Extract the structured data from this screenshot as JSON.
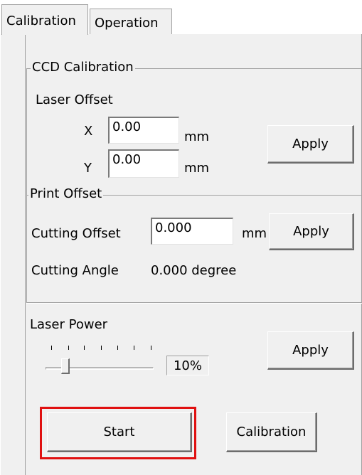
{
  "tabs": [
    {
      "label": "Calibration",
      "active": true
    },
    {
      "label": "Operation",
      "active": false
    }
  ],
  "ccd": {
    "legend": "CCD Calibration",
    "laser_offset_label": "Laser Offset",
    "x_label": "X",
    "x_value": "0.00",
    "y_label": "Y",
    "y_value": "0.00",
    "unit": "mm",
    "apply_label": "Apply"
  },
  "print_offset": {
    "legend": "Print Offset",
    "cutting_offset_label": "Cutting Offset",
    "cutting_offset_value": "0.000",
    "unit": "mm",
    "apply_label": "Apply",
    "cutting_angle_label": "Cutting Angle",
    "cutting_angle_value": "0.000 degree"
  },
  "laser_power": {
    "label": "Laser Power",
    "value_text": "10%",
    "level": 0.1,
    "apply_label": "Apply"
  },
  "actions": {
    "start_label": "Start",
    "calibration_label": "Calibration"
  },
  "colors": {
    "highlight": "#e01010",
    "panel_bg": "#f0f0f0"
  }
}
